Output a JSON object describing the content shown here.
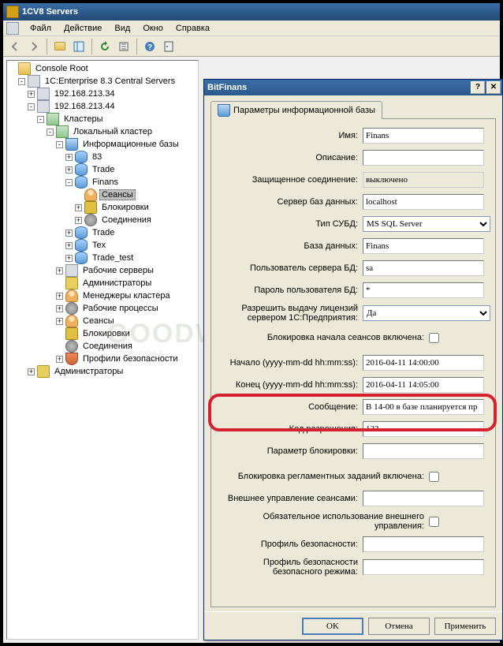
{
  "window": {
    "title": "1CV8 Servers"
  },
  "menu": {
    "file": "Файл",
    "action": "Действие",
    "view": "Вид",
    "window": "Окно",
    "help": "Справка"
  },
  "tree": {
    "root": "Console Root",
    "ent": "1C:Enterprise 8.3 Central Servers",
    "srv1": "192.168.213.34",
    "srv2": "192.168.213.44",
    "clusters": "Кластеры",
    "localCluster": "Локальный кластер",
    "infobases": "Информационные базы",
    "db83": "83",
    "dbTrade": "Trade",
    "dbFinans": "Finans",
    "sessions": "Сеансы",
    "blocks": "Блокировки",
    "connections": "Соединения",
    "dbTrade2": "Trade",
    "dbTex": "Tex",
    "dbTradeTest": "Trade_test",
    "workServers": "Рабочие серверы",
    "admins": "Администраторы",
    "clusterMgrs": "Менеджеры кластера",
    "workProcs": "Рабочие процессы",
    "sessions2": "Сеансы",
    "blocks2": "Блокировки",
    "connections2": "Соединения",
    "secProfiles": "Профили безопасности",
    "admins2": "Администраторы"
  },
  "dialog": {
    "title": "BitFinans",
    "tab": "Параметры информационной базы",
    "labels": {
      "name": "Имя:",
      "desc": "Описание:",
      "secure": "Защищенное соединение:",
      "dbserver": "Сервер баз данных:",
      "dbtype": "Тип СУБД:",
      "dbname": "База данных:",
      "dbuser": "Пользователь сервера БД:",
      "dbpass": "Пароль пользователя БД:",
      "license": "Разрешить выдачу лицензий сервером 1С:Предприятия:",
      "blockStart": "Блокировка начала сеансов включена:",
      "start": "Начало (yyyy-mm-dd hh:mm:ss):",
      "end": "Конец (yyyy-mm-dd hh:mm:ss):",
      "message": "Сообщение:",
      "permitCode": "Код разрешения:",
      "blockParam": "Параметр блокировки:",
      "blockSched": "Блокировка регламентных заданий включена:",
      "extMgmt": "Внешнее управление сеансами:",
      "reqExtMgmt": "Обязательное использование внешнего управления:",
      "secProfile": "Профиль безопасности:",
      "safeModeProfile": "Профиль безопасности безопасного режима:"
    },
    "values": {
      "name": "Finans",
      "desc": "",
      "secure": "выключено",
      "dbserver": "localhost",
      "dbtype": "MS SQL Server",
      "dbname": "Finans",
      "dbuser": "sa",
      "dbpass": "*",
      "license": "Да",
      "start": "2016-04-11 14:00:00",
      "end": "2016-04-11 14:05:00",
      "message": "В 14-00 в базе планируется пр",
      "permitCode": "123",
      "blockParam": "",
      "extMgmt": "",
      "secProfile": "",
      "safeModeProfile": ""
    },
    "buttons": {
      "ok": "OK",
      "cancel": "Отмена",
      "apply": "Применить"
    }
  },
  "watermark": {
    "main": "GOODWILL",
    "sub": "технологии д"
  }
}
